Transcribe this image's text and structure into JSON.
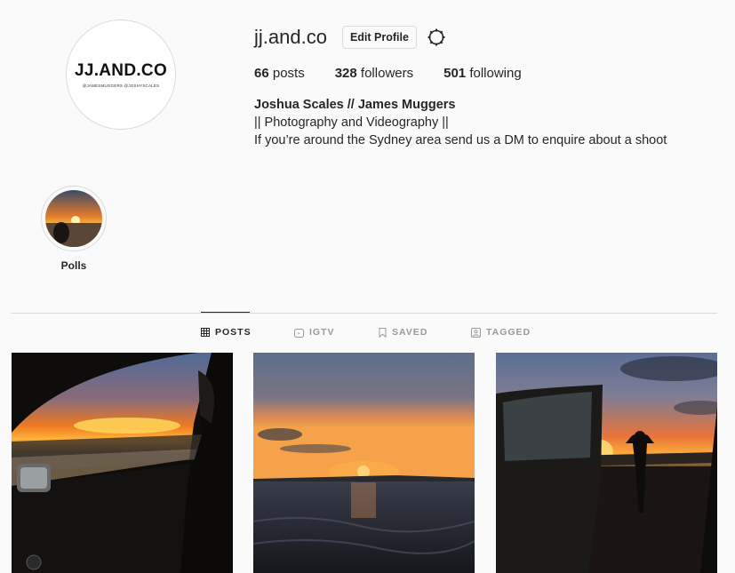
{
  "profile": {
    "username": "jj.and.co",
    "edit_profile_label": "Edit Profile",
    "avatar_logo_text": "JJ.AND.CO",
    "avatar_sub_text": "@JAMESMUGGERS  @JOSHYSCALES",
    "stats": {
      "posts_count": "66",
      "posts_label": "posts",
      "followers_count": "328",
      "followers_label": "followers",
      "following_count": "501",
      "following_label": "following"
    },
    "bio": {
      "name": "Joshua Scales // James Muggers",
      "line1": "|| Photography and Videography ||",
      "line2": "If you’re around the Sydney area send us a DM to enquire about a shoot"
    }
  },
  "highlights": [
    {
      "label": "Polls"
    }
  ],
  "tabs": [
    {
      "label": "POSTS",
      "icon": "grid-icon",
      "active": true
    },
    {
      "label": "IGTV",
      "icon": "igtv-icon",
      "active": false
    },
    {
      "label": "SAVED",
      "icon": "bookmark-icon",
      "active": false
    },
    {
      "label": "TAGGED",
      "icon": "tagged-icon",
      "active": false
    }
  ],
  "colors": {
    "background": "#fafafa",
    "text": "#262626",
    "muted": "#999999",
    "border": "#dbdbdb"
  }
}
